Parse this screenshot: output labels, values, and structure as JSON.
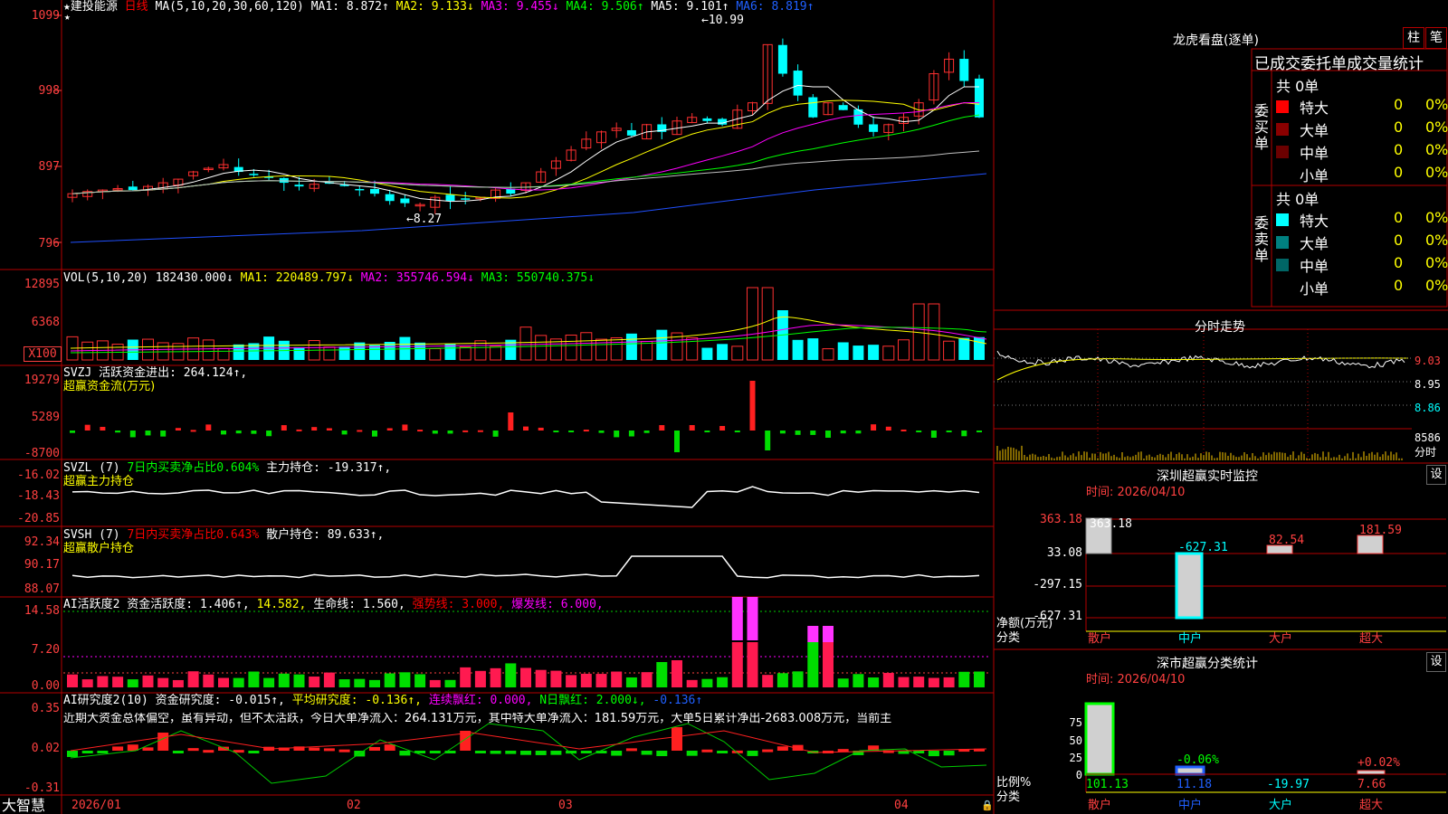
{
  "header": {
    "stock_name": "建投能源",
    "period": "日线",
    "ma_label": "MA(5,10,20,30,60,120)",
    "ma1": "MA1: 8.872↑",
    "ma2": "MA2: 9.133↓",
    "ma3": "MA3: 9.455↓",
    "ma4": "MA4: 9.506↑",
    "ma5": "MA5: 9.101↑",
    "ma6": "MA6: 8.819↑",
    "high_mark": "10.99",
    "low_mark": "8.27"
  },
  "price_axis": [
    "1099",
    "998",
    "897",
    "796"
  ],
  "vol_axis": [
    "12895",
    "6368",
    "X100"
  ],
  "svzj_axis": [
    "19279",
    "5289",
    "-8700"
  ],
  "svzl_axis": [
    "-16.02",
    "-18.43",
    "-20.85"
  ],
  "svsh_axis": [
    "92.34",
    "90.17",
    "88.07"
  ],
  "ai_axis": [
    "14.58",
    "7.20",
    "0.00"
  ],
  "ai2_axis": [
    "0.35",
    "0.02",
    "-0.31"
  ],
  "volume_panel": {
    "label": "VOL(5,10,20)",
    "value": "182430.000↓",
    "ma1": "MA1: 220489.797↓",
    "ma2": "MA2: 355746.594↓",
    "ma3": "MA3: 550740.375↓"
  },
  "svzj_panel": {
    "label": "SVZJ  活跃资金进出: 264.124↑,",
    "sub": "超赢资金流(万元)"
  },
  "svzl_panel": {
    "label": "SVZL (7)",
    "ratio": "7日内买卖净占比0.604%",
    "hold": "主力持仓: -19.317↑,",
    "sub": "超赢主力持仓"
  },
  "svsh_panel": {
    "label": "SVSH (7)",
    "ratio": "7日内买卖净占比0.643%",
    "hold": "散户持仓: 89.633↑,",
    "sub": "超赢散户持仓"
  },
  "ai_panel": {
    "label": "AI活跃度2 资金活跃度: 1.406↑",
    "v2": "14.582,",
    "v3": "生命线: 1.560,",
    "v4": "强势线: 3.000,",
    "v5": "爆发线: 6.000,"
  },
  "ai2_panel": {
    "label": "AI研究度2(10) 资金研究度: -0.015↑,",
    "v2": "平均研究度: -0.136↑,",
    "v3": "连续飘红: 0.000,",
    "v4": "N日飘红: 2.000↓,",
    "v5": "-0.136↑",
    "commentary": "近期大资金总体偏空，虽有异动，但不太活跃，今日大单净流入：264.131万元，其中特大单净流入：181.59万元，大单5日累计净出-2683.008万元，当前主"
  },
  "bottom_axis": {
    "brand": "大智慧",
    "dates": [
      "2026/01",
      "02",
      "03",
      "04"
    ]
  },
  "longhu": {
    "title": "龙虎看盘(逐单)",
    "btn1": "柱",
    "btn2": "笔",
    "subtitle": "已成交委托单成交量统计",
    "buy_label": "委买单",
    "sell_label": "委卖单",
    "buy_total": "共 0单",
    "sell_total": "共 0单",
    "buy_rows": [
      {
        "name": "特大",
        "count": "0",
        "pct": "0%",
        "color": "#ff0000"
      },
      {
        "name": "大单",
        "count": "0",
        "pct": "0%",
        "color": "#8b0000"
      },
      {
        "name": "中单",
        "count": "0",
        "pct": "0%",
        "color": "#6b0000"
      },
      {
        "name": "小单",
        "count": "0",
        "pct": "0%",
        "color": "#000000"
      }
    ],
    "sell_rows": [
      {
        "name": "特大",
        "count": "0",
        "pct": "0%",
        "color": "#00ffff"
      },
      {
        "name": "大单",
        "count": "0",
        "pct": "0%",
        "color": "#008080"
      },
      {
        "name": "中单",
        "count": "0",
        "pct": "0%",
        "color": "#006666"
      },
      {
        "name": "小单",
        "count": "0",
        "pct": "0%",
        "color": "#000000"
      }
    ]
  },
  "intraday": {
    "title": "分时走势",
    "axis": [
      "9.03",
      "8.95",
      "8.86",
      "8586",
      "分时"
    ]
  },
  "sz_monitor": {
    "title": "深圳超赢实时监控",
    "btn": "设",
    "time": "时间: 2026/04/10",
    "axis": [
      "363.18",
      "33.08",
      "-297.15",
      "-627.31"
    ],
    "ylabel1": "净额(万元)",
    "ylabel2": "分类",
    "categories": [
      "散户",
      "中户",
      "大户",
      "超大"
    ],
    "values": [
      "363.18",
      "-627.31",
      "82.54",
      "181.59"
    ]
  },
  "sz_class": {
    "title": "深市超赢分类统计",
    "btn": "设",
    "time": "时间: 2026/04/10",
    "axis": [
      "75",
      "50",
      "25",
      "0"
    ],
    "ylabel1": "比例%",
    "ylabel2": "分类",
    "categories": [
      "散户",
      "中户",
      "大户",
      "超大"
    ],
    "values": [
      "101.13",
      "11.18",
      "-19.97",
      "7.66"
    ],
    "bar_labels": [
      "",
      "-0.06%",
      "",
      "+0.02%"
    ]
  }
}
